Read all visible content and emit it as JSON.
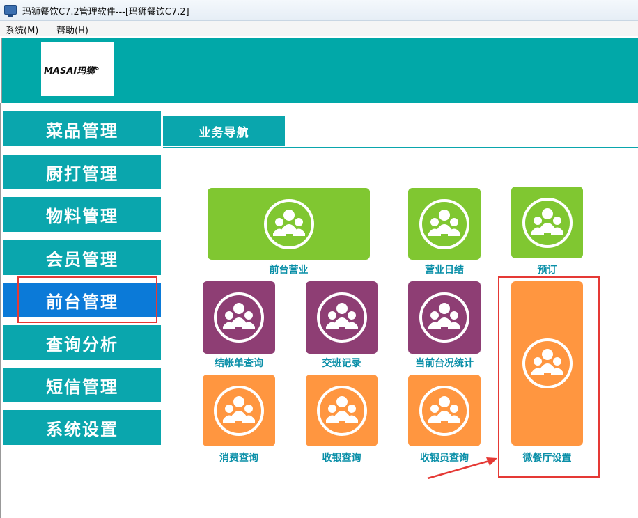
{
  "window": {
    "title": "玛狮餐饮C7.2管理软件---[玛狮餐饮C7.2]"
  },
  "menu": {
    "items": [
      "系统(M)",
      "帮助(H)"
    ]
  },
  "logo": {
    "text": "MASAI玛狮°"
  },
  "sidebar": {
    "items": [
      "菜品管理",
      "厨打管理",
      "物料管理",
      "会员管理",
      "前台管理",
      "查询分析",
      "短信管理",
      "系统设置"
    ],
    "active_index": 4
  },
  "tab": {
    "label": "业务导航"
  },
  "tiles": [
    {
      "label": "前台营业",
      "color": "green"
    },
    {
      "label": "营业日结",
      "color": "green"
    },
    {
      "label": "预订",
      "color": "green"
    },
    {
      "label": "结帐单查询",
      "color": "purple"
    },
    {
      "label": "交班记录",
      "color": "purple"
    },
    {
      "label": "当前台况统计",
      "color": "purple"
    },
    {
      "label": "微餐厅设置",
      "color": "orange"
    },
    {
      "label": "消费查询",
      "color": "orange"
    },
    {
      "label": "收银查询",
      "color": "orange"
    },
    {
      "label": "收银员查询",
      "color": "orange"
    }
  ],
  "colors": {
    "teal": "#0aa6ad",
    "active": "#0b7ad8",
    "green": "#80c731",
    "purple": "#8e3e74",
    "orange": "#ff9640",
    "label": "#0a8fa8",
    "annotation": "#e53935"
  },
  "icons": {
    "tile": "people-group-icon",
    "app": "monitor-icon"
  }
}
